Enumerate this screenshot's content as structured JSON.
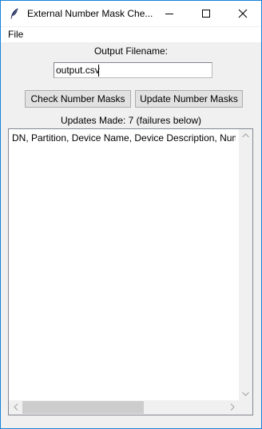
{
  "window": {
    "title": "External Number Mask Che..."
  },
  "menu": {
    "items": [
      "File"
    ]
  },
  "form": {
    "output_label": "Output Filename:",
    "output_value": "output.csv"
  },
  "buttons": {
    "check": "Check Number Masks",
    "update": "Update Number Masks"
  },
  "status": {
    "updates": "Updates Made: 7 (failures below)"
  },
  "results": {
    "lines": [
      "DN, Partition, Device Name, Device Description, Num"
    ]
  },
  "scroll": {
    "horizontal_position": 0.0,
    "horizontal_visible_fraction": 0.57,
    "vertical_position": 0.0
  },
  "icons": {
    "app": "feather-icon",
    "minimize": "minimize-icon",
    "maximize": "maximize-icon",
    "close": "close-icon"
  },
  "colors": {
    "window_border": "#1883d7",
    "titlebar": "#ffffff",
    "background": "#f0f0f0",
    "button": "#e1e1e1",
    "scroll_thumb": "#cdcdcd"
  }
}
